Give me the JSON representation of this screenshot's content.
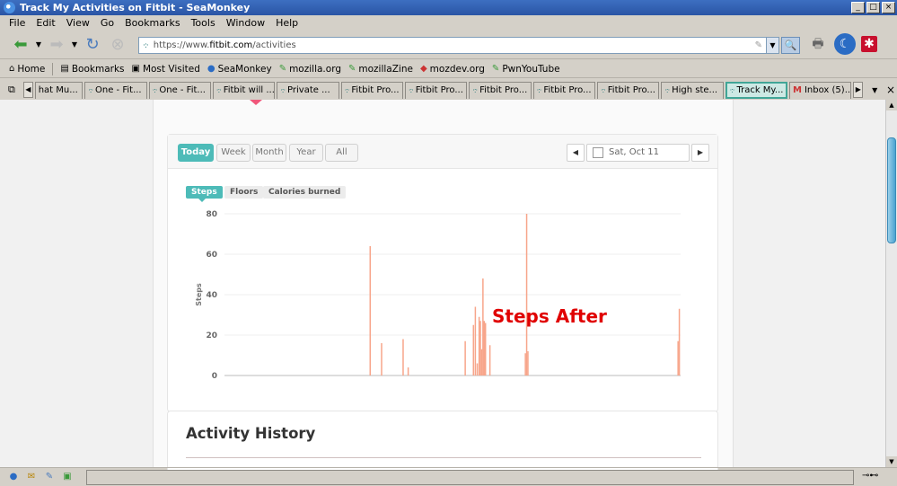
{
  "window": {
    "title": "Track My Activities on Fitbit - SeaMonkey"
  },
  "menu": [
    "File",
    "Edit",
    "View",
    "Go",
    "Bookmarks",
    "Tools",
    "Window",
    "Help"
  ],
  "nav": {
    "url_prefix": "https://www.",
    "url_domain": "fitbit.com",
    "url_path": "/activities"
  },
  "bookmarks": [
    {
      "label": "Home",
      "icon": "home-icon"
    },
    {
      "label": "Bookmarks",
      "icon": "bookmarks-icon"
    },
    {
      "label": "Most Visited",
      "icon": "most-visited-icon"
    },
    {
      "label": "SeaMonkey",
      "icon": "seamonkey-icon"
    },
    {
      "label": "mozilla.org",
      "icon": "link-icon"
    },
    {
      "label": "mozillaZine",
      "icon": "link-icon"
    },
    {
      "label": "mozdev.org",
      "icon": "mozdev-icon"
    },
    {
      "label": "PwnYouTube",
      "icon": "link-icon"
    }
  ],
  "tabs": [
    {
      "label": "hat Mu..."
    },
    {
      "label": "One - Fit..."
    },
    {
      "label": "One - Fit..."
    },
    {
      "label": "Fitbit will ..."
    },
    {
      "label": "Private ..."
    },
    {
      "label": "Fitbit Pro..."
    },
    {
      "label": "Fitbit Pro..."
    },
    {
      "label": "Fitbit Pro..."
    },
    {
      "label": "Fitbit Pro..."
    },
    {
      "label": "Fitbit Pro..."
    },
    {
      "label": "High ste..."
    },
    {
      "label": "Track My..."
    },
    {
      "label": "Inbox (5)..."
    }
  ],
  "range_buttons": [
    "Today",
    "Week",
    "Month",
    "Year",
    "All"
  ],
  "date_label": "Sat, Oct 11",
  "metrics": [
    "Steps",
    "Floors",
    "Calories burned"
  ],
  "annotation": "Steps After",
  "history_title": "Activity History",
  "chart_data": {
    "type": "bar",
    "ylabel": "Steps",
    "ylim": [
      0,
      80
    ],
    "yticks": [
      "80",
      "60",
      "40",
      "20",
      "0"
    ],
    "x_range": [
      0,
      1440
    ],
    "bars": [
      {
        "x": 460,
        "y": 64
      },
      {
        "x": 496,
        "y": 16
      },
      {
        "x": 564,
        "y": 18
      },
      {
        "x": 580,
        "y": 4
      },
      {
        "x": 760,
        "y": 17
      },
      {
        "x": 786,
        "y": 25
      },
      {
        "x": 792,
        "y": 34
      },
      {
        "x": 798,
        "y": 6
      },
      {
        "x": 804,
        "y": 29
      },
      {
        "x": 808,
        "y": 27
      },
      {
        "x": 812,
        "y": 13
      },
      {
        "x": 816,
        "y": 48
      },
      {
        "x": 820,
        "y": 27
      },
      {
        "x": 824,
        "y": 26
      },
      {
        "x": 838,
        "y": 15
      },
      {
        "x": 950,
        "y": 11
      },
      {
        "x": 954,
        "y": 80
      },
      {
        "x": 958,
        "y": 12
      },
      {
        "x": 1432,
        "y": 17
      },
      {
        "x": 1436,
        "y": 33
      }
    ],
    "bar_color": "#f7a58a",
    "grid": true
  }
}
